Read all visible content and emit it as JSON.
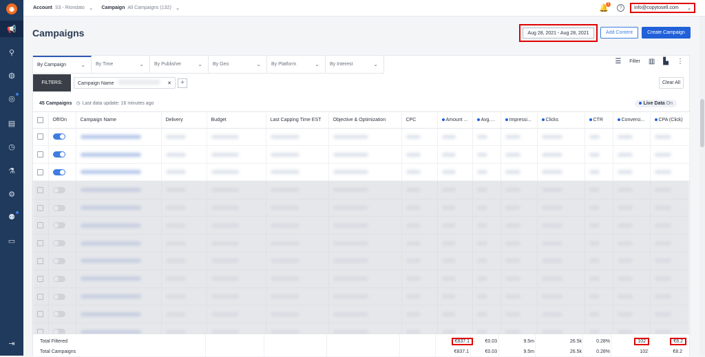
{
  "topbar": {
    "account_label": "Account",
    "account_value": "S3 - Riondato",
    "campaign_label": "Campaign",
    "campaign_value": "All Campaigns (132)",
    "notification_count": "1",
    "user_email": "info@copytosell.com"
  },
  "header": {
    "title": "Campaigns",
    "date_range": "Aug 28, 2021 - Aug 28, 2021",
    "add_content": "Add Content",
    "create_campaign": "Create Campaign"
  },
  "tabs": [
    {
      "label": "By Campaign"
    },
    {
      "label": "By Time"
    },
    {
      "label": "By Publisher"
    },
    {
      "label": "By Geo"
    },
    {
      "label": "By Platform"
    },
    {
      "label": "By Interest"
    }
  ],
  "toolbar": {
    "filter_label": "Filter"
  },
  "filters": {
    "label": "FILTERS:",
    "chip_label": "Campaign Name",
    "clear_all": "Clear All"
  },
  "summary": {
    "count": "45 Campaigns",
    "last_update": "Last data update: 16 minutes ago",
    "live_label": "Live Data",
    "live_state": "On"
  },
  "table": {
    "columns": [
      "",
      "Off/On",
      "Campaign Name",
      "Delivery",
      "Budget",
      "Last Capping Time EST",
      "Objective & Optimization",
      "CPC",
      "Amount ...",
      "Avg. C...",
      "Impressi...",
      "Clicks",
      "CTR",
      "Conversi...",
      "CPA (Click)"
    ],
    "metric_columns": [
      8,
      9,
      10,
      11,
      12,
      13,
      14
    ]
  },
  "totals": {
    "filtered": {
      "label": "Total Filtered",
      "amount": "€837.1",
      "avg_cpc": "€0.03",
      "impressions": "9.5m",
      "clicks": "26.5k",
      "ctr": "0.28%",
      "conversions": "102",
      "cpa": "€8.2"
    },
    "campaigns": {
      "label": "Total Campaigns",
      "amount": "€837.1",
      "avg_cpc": "€0.03",
      "impressions": "9.5m",
      "clicks": "26.5k",
      "ctr": "0.28%",
      "conversions": "102",
      "cpa": "€8.2"
    }
  },
  "colors": {
    "sidebar": "#1f3a5c",
    "accent": "#2160d8",
    "highlight": "#e00000",
    "brand": "#f26b21"
  }
}
